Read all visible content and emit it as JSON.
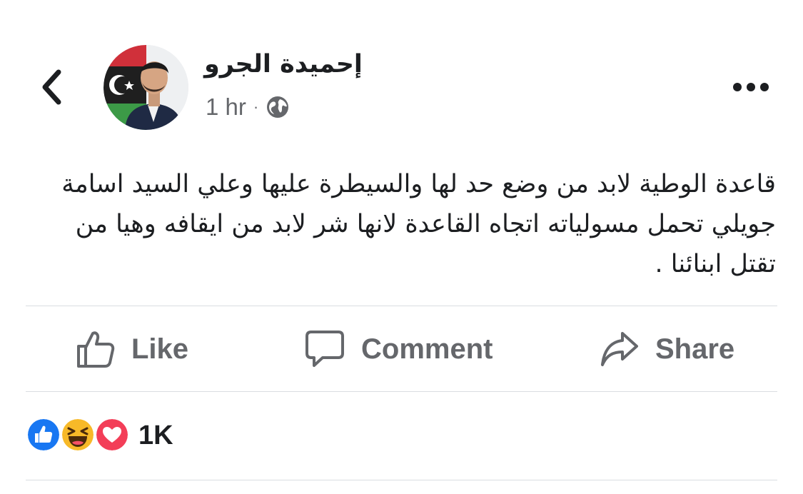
{
  "post": {
    "author_name": "إحميدة الجرو",
    "timestamp": "1 hr",
    "separator": "·",
    "privacy_icon": "globe-icon",
    "body_text": "قاعدة الوطية لابد من وضع حد لها والسيطرة عليها وعلي السيد اسامة جويلي تحمل مسولياته اتجاه القاعدة لانها شر لابد من ايقافه وهيا من تقتل ابنائنا ."
  },
  "header": {
    "back_icon": "chevron-left-icon",
    "more_icon": "more-dots-icon"
  },
  "actions": {
    "like_label": "Like",
    "comment_label": "Comment",
    "share_label": "Share"
  },
  "reactions": {
    "icons": [
      "like-reaction-icon",
      "haha-reaction-icon",
      "love-reaction-icon"
    ],
    "count": "1K"
  },
  "colors": {
    "text": "#1c1e21",
    "secondary": "#65676b",
    "divider": "#dadde1",
    "like_blue": "#1877f2",
    "love_red": "#f33e58",
    "haha_yellow": "#f7b928"
  }
}
